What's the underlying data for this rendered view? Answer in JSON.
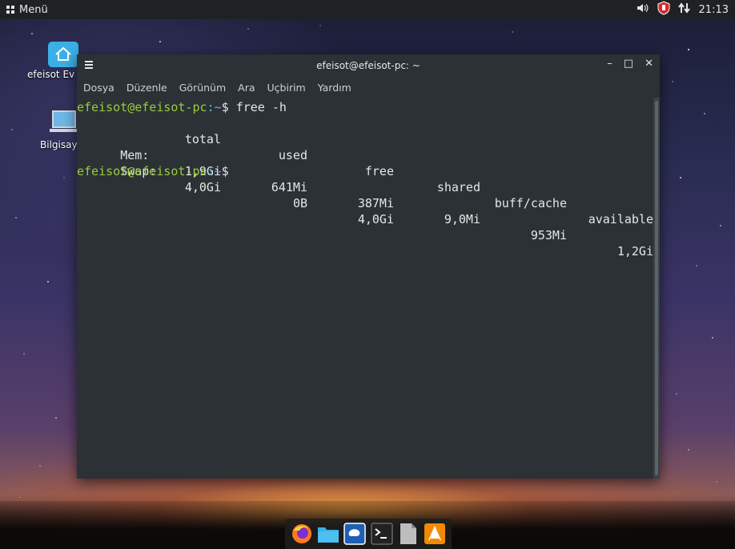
{
  "top_panel": {
    "menu_label": "Menü",
    "clock": "21:13"
  },
  "desktop": {
    "icons": [
      {
        "label": "efeisot Ev Dizini"
      },
      {
        "label": "Bilgisayar"
      }
    ]
  },
  "terminal": {
    "title": "efeisot@efeisot-pc: ~",
    "menu": [
      "Dosya",
      "Düzenle",
      "Görünüm",
      "Ara",
      "Uçbirim",
      "Yardım"
    ],
    "prompt_user": "efeisot@efeisot-pc",
    "prompt_path": ":~",
    "prompt_symbol": "$ ",
    "command": "free -h",
    "table": {
      "headers": [
        "total",
        "used",
        "free",
        "shared",
        "buff/cache",
        "available"
      ],
      "rows": [
        {
          "label": "Mem:",
          "cells": [
            "1,9Gi",
            "641Mi",
            "387Mi",
            "9,0Mi",
            "953Mi",
            "1,2Gi"
          ]
        },
        {
          "label": "Swap:",
          "cells": [
            "4,0Gi",
            "0B",
            "4,0Gi",
            "",
            "",
            ""
          ]
        }
      ]
    }
  },
  "dock": {
    "apps": [
      "firefox-icon",
      "files-icon",
      "mail-icon",
      "terminal-icon",
      "text-editor-icon",
      "vlc-icon"
    ]
  },
  "colors": {
    "prompt_user": "#9ccc3b",
    "prompt_path": "#5ab4e8",
    "terminal_bg": "#2b3134"
  }
}
